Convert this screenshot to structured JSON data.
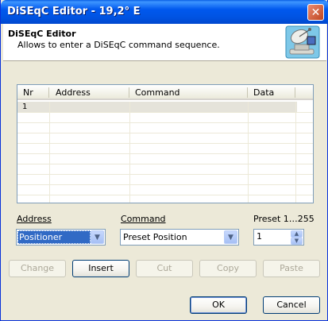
{
  "window": {
    "title": "DiSEqC Editor - 19,2° E"
  },
  "header": {
    "title": "DiSEqC Editor",
    "subtitle": "Allows to enter a DiSEqC command sequence."
  },
  "list": {
    "columns": [
      "Nr",
      "Address",
      "Command",
      "Data"
    ],
    "rows": [
      {
        "nr": "1",
        "address": "",
        "command": "",
        "data": ""
      }
    ]
  },
  "address": {
    "label": "Address",
    "value": "Positioner"
  },
  "command": {
    "label": "Command",
    "value": "Preset Position"
  },
  "preset": {
    "label": "Preset 1…255",
    "value": "1"
  },
  "actions": {
    "change": "Change",
    "insert": "Insert",
    "cut": "Cut",
    "copy": "Copy",
    "paste": "Paste"
  },
  "dialog": {
    "ok": "OK",
    "cancel": "Cancel"
  },
  "colors": {
    "titlebar": "#0054e3",
    "selection": "#316ac5",
    "face": "#ece9d8"
  }
}
